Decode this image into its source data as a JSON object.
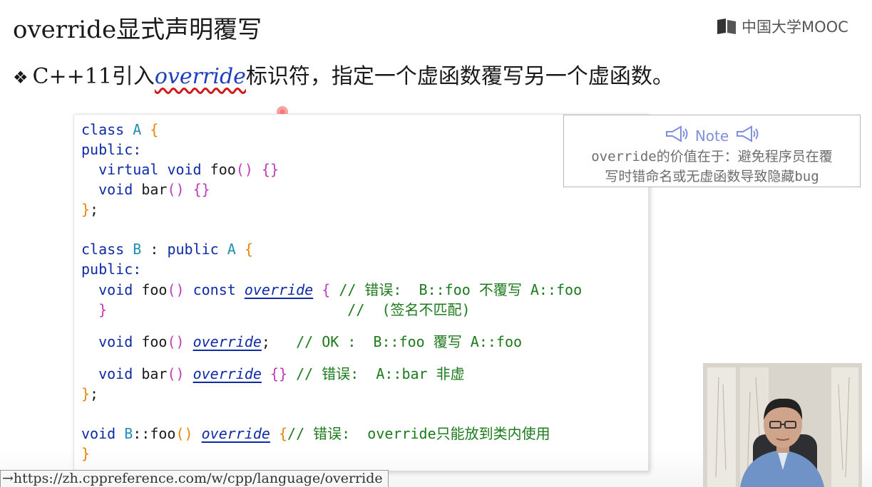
{
  "slide": {
    "title": "override显式声明覆写",
    "bullet_mark": "❖",
    "bullet_pre": "C++11引入",
    "bullet_keyword": "override",
    "bullet_post": "标识符，指定一个虚函数覆写另一个虚函数。"
  },
  "logo": {
    "text": "中国大学MOOC"
  },
  "note": {
    "title": "Note",
    "line1": "override的价值在于：避免程序员在覆",
    "line2": "写时错命名或无虚函数导致隐藏bug"
  },
  "code": {
    "l1": {
      "kw": "class",
      "name": "A",
      "brace": "{"
    },
    "l2": {
      "kw": "public:"
    },
    "l3": {
      "kw1": "virtual",
      "kw2": "void",
      "name": "foo",
      "paren": "()",
      "body": "{}"
    },
    "l4": {
      "kw": "void",
      "name": "bar",
      "paren": "()",
      "body": "{}"
    },
    "l5": {
      "brace": "}",
      "semi": ";"
    },
    "l7": {
      "kw1": "class",
      "name": "B",
      "colon": ":",
      "kw2": "public",
      "base": "A",
      "brace": "{"
    },
    "l8": {
      "kw": "public:"
    },
    "l9": {
      "kw": "void",
      "name": "foo",
      "paren": "()",
      "const": "const",
      "ov": "override",
      "brace": "{",
      "comment": "// 错误:  B::foo 不覆写 A::foo"
    },
    "l10": {
      "brace": "}",
      "comment": "//  (签名不匹配)"
    },
    "l11": {
      "kw": "void",
      "name": "foo",
      "paren": "()",
      "ov": "override",
      "semi": ";",
      "comment": "// OK :  B::foo 覆写 A::foo"
    },
    "l12": {
      "kw": "void",
      "name": "bar",
      "paren": "()",
      "ov": "override",
      "body": "{}",
      "comment": "// 错误:  A::bar 非虚"
    },
    "l13": {
      "brace": "}",
      "semi": ";"
    },
    "l15": {
      "kw": "void",
      "scope": "B",
      "name": "::foo",
      "paren": "()",
      "ov": "override",
      "brace": "{",
      "comment": "// 错误:  override只能放到类内使用"
    },
    "l16": {
      "brace": "}"
    }
  },
  "url_bar": {
    "text": "→https://zh.cppreference.com/w/cpp/language/override"
  },
  "colors": {
    "keyword": "#0e2aa6",
    "type_name": "#1e8fb0",
    "paren": "#e8850a",
    "brace": "#c23ab8",
    "comment": "#1d7a1d",
    "note_title": "#7f8fdc"
  },
  "icons": [
    "megaphone-icon",
    "mooc-logo-icon"
  ]
}
